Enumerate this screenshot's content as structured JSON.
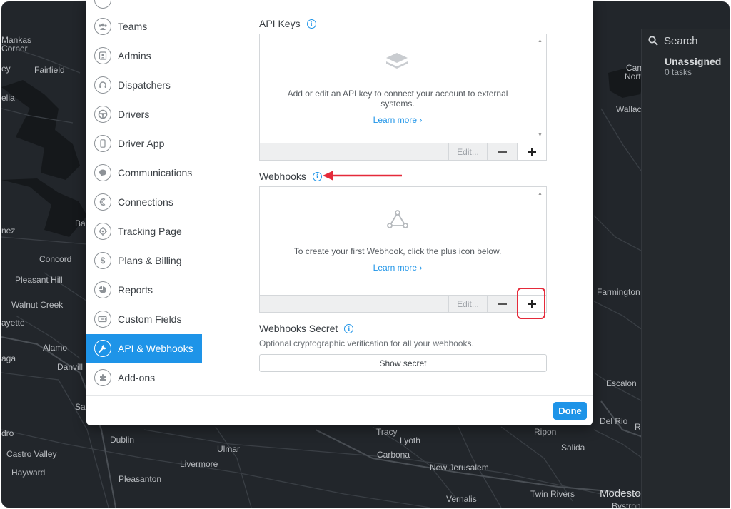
{
  "map": {
    "labels": [
      "Mankas",
      "Corner",
      "ey",
      "Fairfield",
      "elia",
      "nez",
      "Ba",
      "Concord",
      "Pleasant Hill",
      "Walnut Creek",
      "ayette",
      "Alamo",
      "aga",
      "Danvill",
      "Sa",
      "dro",
      "Castro Valley",
      "Hayward",
      "Dublin",
      "Ulmar",
      "Livermore",
      "Pleasanton",
      "Tracy",
      "Lyoth",
      "Carbona",
      "New Jerusalem",
      "Vernalis",
      "Salida",
      "Twin Rivers",
      "Modesto",
      "Bystron",
      "Ripon",
      "Del Rio",
      "R",
      "Escalon",
      "Farmington",
      "Can",
      "Nort",
      "Wallac"
    ]
  },
  "task_panel": {
    "search_label": "Search",
    "unassigned_title": "Unassigned",
    "unassigned_count": "0 tasks"
  },
  "sidebar": {
    "items": [
      {
        "label": "Teams",
        "icon": "teams-icon"
      },
      {
        "label": "Admins",
        "icon": "admins-icon"
      },
      {
        "label": "Dispatchers",
        "icon": "headset-icon"
      },
      {
        "label": "Drivers",
        "icon": "steering-wheel-icon"
      },
      {
        "label": "Driver App",
        "icon": "phone-icon"
      },
      {
        "label": "Communications",
        "icon": "chat-bubble-icon"
      },
      {
        "label": "Connections",
        "icon": "connections-icon"
      },
      {
        "label": "Tracking Page",
        "icon": "crosshair-icon"
      },
      {
        "label": "Plans & Billing",
        "icon": "dollar-icon"
      },
      {
        "label": "Reports",
        "icon": "pie-chart-icon"
      },
      {
        "label": "Custom Fields",
        "icon": "custom-fields-icon"
      },
      {
        "label": "API & Webhooks",
        "icon": "wrench-icon"
      },
      {
        "label": "Add-ons",
        "icon": "puzzle-icon"
      }
    ],
    "active_index": 11
  },
  "api_keys": {
    "title": "API Keys",
    "info": "i",
    "empty_text": "Add or edit an API key to connect your account to external systems.",
    "learn_more": "Learn more ›",
    "edit_label": "Edit..."
  },
  "webhooks": {
    "title": "Webhooks",
    "info": "i",
    "empty_text": "To create your first Webhook, click the plus icon below.",
    "learn_more": "Learn more ›",
    "edit_label": "Edit..."
  },
  "webhooks_secret": {
    "title": "Webhooks Secret",
    "info": "i",
    "description": "Optional cryptographic verification for all your webhooks.",
    "button_label": "Show secret"
  },
  "footer": {
    "done_label": "Done"
  },
  "colors": {
    "accent": "#1e94e8",
    "annotation_red": "#e52a3a",
    "map_background": "#22262b"
  }
}
